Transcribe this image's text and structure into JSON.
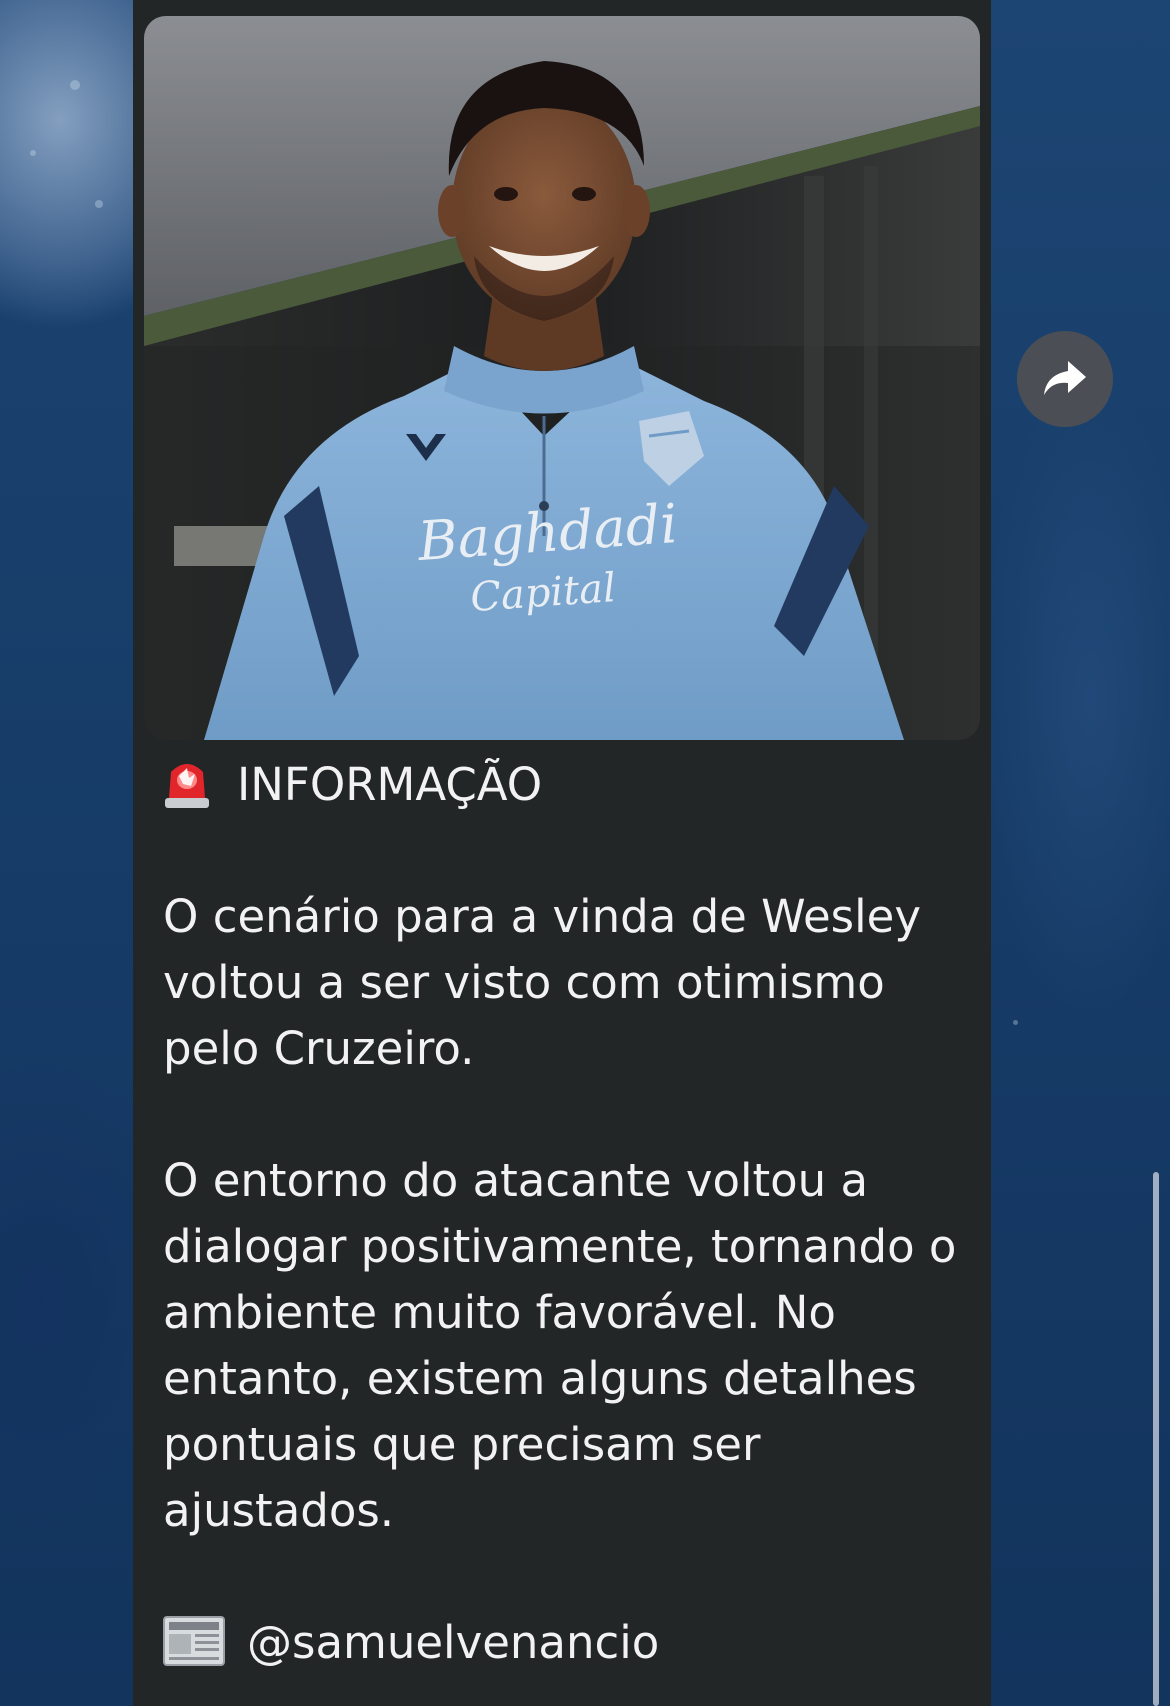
{
  "message": {
    "heading": "INFORMAÇÃO",
    "lines": [
      "O cenário para a vinda de Wesley",
      "voltou a ser visto com otimismo",
      "pelo Cruzeiro.",
      "",
      "O entorno do atacante voltou a",
      "dialogar positivamente, tornando o",
      "ambiente muito favorável. No",
      "entanto, existem alguns detalhes",
      "pontuais que precisam ser",
      "ajustados."
    ],
    "source_handle": "@samuelvenancio"
  },
  "photo": {
    "sponsor_line1": "Baghdadi",
    "sponsor_line2": "Capital"
  },
  "icons": {
    "heading_emoji": "police-light-siren-icon",
    "source_emoji": "newspaper-icon",
    "forward": "forward-arrow-icon"
  },
  "colors": {
    "bubble_bg": "#222627",
    "text": "#f2f2f2",
    "forward_button_bg": "#4b4f55",
    "wallpaper": "#163a63",
    "jersey": "#7faad3"
  }
}
